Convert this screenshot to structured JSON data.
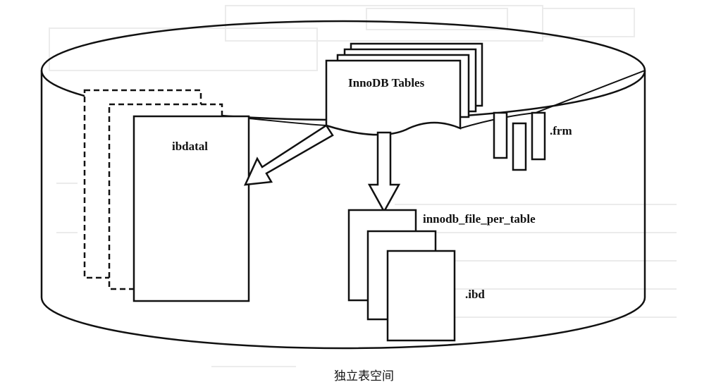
{
  "diagram": {
    "innodb_tables_label": "InnoDB Tables",
    "ibdata_label": "ibdatal",
    "frm_label": ".frm",
    "file_per_table_label": "innodb_file_per_table",
    "ibd_label": ".ibd",
    "caption": "独立表空间"
  },
  "colors": {
    "ink": "#111111",
    "paper": "#ffffff",
    "scan_texture": "#c8c8c8"
  }
}
